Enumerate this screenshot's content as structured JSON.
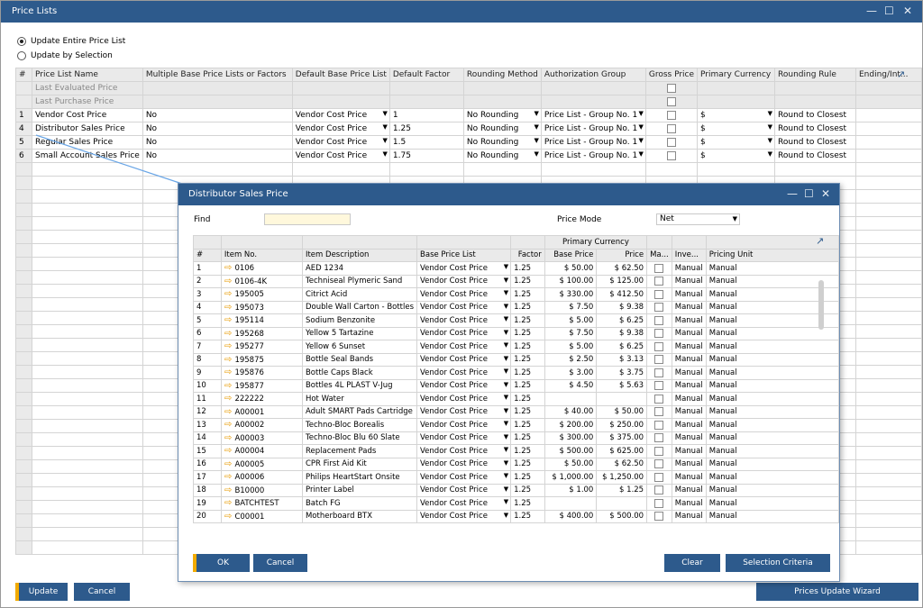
{
  "window": {
    "title": "Price Lists"
  },
  "options": {
    "update_entire": "Update Entire Price List",
    "update_selection": "Update by Selection"
  },
  "grid": {
    "headers": [
      "#",
      "Price List Name",
      "Multiple Base Price Lists or Factors",
      "Default Base Price List",
      "Default Factor",
      "Rounding Method",
      "Authorization Group",
      "Gross Price",
      "Primary Currency",
      "Rounding Rule",
      "Ending/Int..."
    ],
    "special_rows": [
      "Last Evaluated Price",
      "Last Purchase Price"
    ],
    "rows": [
      {
        "no": "1",
        "name": "Vendor Cost Price",
        "multi": "No",
        "base": "Vendor Cost Price",
        "factor": "1",
        "rounding": "No Rounding",
        "auth": "Price List - Group No. 1",
        "currency": "$",
        "rule": "Round to Closest"
      },
      {
        "no": "4",
        "name": "Distributor Sales Price",
        "multi": "No",
        "base": "Vendor Cost Price",
        "factor": "1.25",
        "rounding": "No Rounding",
        "auth": "Price List - Group No. 1",
        "currency": "$",
        "rule": "Round to Closest"
      },
      {
        "no": "5",
        "name": "Regular Sales Price",
        "multi": "No",
        "base": "Vendor Cost Price",
        "factor": "1.5",
        "rounding": "No Rounding",
        "auth": "Price List - Group No. 1",
        "currency": "$",
        "rule": "Round to Closest"
      },
      {
        "no": "6",
        "name": "Small Account Sales Price",
        "multi": "No",
        "base": "Vendor Cost Price",
        "factor": "1.75",
        "rounding": "No Rounding",
        "auth": "Price List - Group No. 1",
        "currency": "$",
        "rule": "Round to Closest"
      }
    ]
  },
  "buttons": {
    "update": "Update",
    "cancel": "Cancel",
    "wizard": "Prices Update Wizard"
  },
  "dialog": {
    "title": "Distributor Sales Price",
    "find_label": "Find",
    "find_value": "",
    "price_mode_label": "Price Mode",
    "price_mode_value": "Net",
    "group_header": "Primary Currency",
    "headers": [
      "#",
      "Item No.",
      "Item Description",
      "Base Price List",
      "Factor",
      "Base Price",
      "Price",
      "Ma...",
      "Inve...",
      "Pricing Unit"
    ],
    "rows": [
      {
        "n": "1",
        "item": "0106",
        "desc": "AED 1234",
        "base": "Vendor Cost Price",
        "factor": "1.25",
        "bp": "$ 50.00",
        "price": "$ 62.50",
        "inv": "Manual",
        "unit": "Manual"
      },
      {
        "n": "2",
        "item": "0106-4K",
        "desc": "Techniseal Plymeric Sand",
        "base": "Vendor Cost Price",
        "factor": "1.25",
        "bp": "$ 100.00",
        "price": "$ 125.00",
        "inv": "Manual",
        "unit": "Manual"
      },
      {
        "n": "3",
        "item": "195005",
        "desc": "Citrict Acid",
        "base": "Vendor Cost Price",
        "factor": "1.25",
        "bp": "$ 330.00",
        "price": "$ 412.50",
        "inv": "Manual",
        "unit": "Manual"
      },
      {
        "n": "4",
        "item": "195073",
        "desc": "Double Wall Carton - Bottles",
        "base": "Vendor Cost Price",
        "factor": "1.25",
        "bp": "$ 7.50",
        "price": "$ 9.38",
        "inv": "Manual",
        "unit": "Manual"
      },
      {
        "n": "5",
        "item": "195114",
        "desc": "Sodium Benzonite",
        "base": "Vendor Cost Price",
        "factor": "1.25",
        "bp": "$ 5.00",
        "price": "$ 6.25",
        "inv": "Manual",
        "unit": "Manual"
      },
      {
        "n": "6",
        "item": "195268",
        "desc": "Yellow 5 Tartazine",
        "base": "Vendor Cost Price",
        "factor": "1.25",
        "bp": "$ 7.50",
        "price": "$ 9.38",
        "inv": "Manual",
        "unit": "Manual"
      },
      {
        "n": "7",
        "item": "195277",
        "desc": "Yellow 6 Sunset",
        "base": "Vendor Cost Price",
        "factor": "1.25",
        "bp": "$ 5.00",
        "price": "$ 6.25",
        "inv": "Manual",
        "unit": "Manual"
      },
      {
        "n": "8",
        "item": "195875",
        "desc": "Bottle Seal Bands",
        "base": "Vendor Cost Price",
        "factor": "1.25",
        "bp": "$ 2.50",
        "price": "$ 3.13",
        "inv": "Manual",
        "unit": "Manual"
      },
      {
        "n": "9",
        "item": "195876",
        "desc": "Bottle Caps Black",
        "base": "Vendor Cost Price",
        "factor": "1.25",
        "bp": "$ 3.00",
        "price": "$ 3.75",
        "inv": "Manual",
        "unit": "Manual"
      },
      {
        "n": "10",
        "item": "195877",
        "desc": "Bottles 4L PLAST V-Jug",
        "base": "Vendor Cost Price",
        "factor": "1.25",
        "bp": "$ 4.50",
        "price": "$ 5.63",
        "inv": "Manual",
        "unit": "Manual"
      },
      {
        "n": "11",
        "item": "222222",
        "desc": "Hot Water",
        "base": "Vendor Cost Price",
        "factor": "1.25",
        "bp": "",
        "price": "",
        "inv": "Manual",
        "unit": "Manual"
      },
      {
        "n": "12",
        "item": "A00001",
        "desc": "Adult SMART Pads Cartridge",
        "base": "Vendor Cost Price",
        "factor": "1.25",
        "bp": "$ 40.00",
        "price": "$ 50.00",
        "inv": "Manual",
        "unit": "Manual"
      },
      {
        "n": "13",
        "item": "A00002",
        "desc": "Techno-Bloc Borealis",
        "base": "Vendor Cost Price",
        "factor": "1.25",
        "bp": "$ 200.00",
        "price": "$ 250.00",
        "inv": "Manual",
        "unit": "Manual"
      },
      {
        "n": "14",
        "item": "A00003",
        "desc": "Techno-Bloc Blu 60 Slate",
        "base": "Vendor Cost Price",
        "factor": "1.25",
        "bp": "$ 300.00",
        "price": "$ 375.00",
        "inv": "Manual",
        "unit": "Manual"
      },
      {
        "n": "15",
        "item": "A00004",
        "desc": "Replacement Pads",
        "base": "Vendor Cost Price",
        "factor": "1.25",
        "bp": "$ 500.00",
        "price": "$ 625.00",
        "inv": "Manual",
        "unit": "Manual"
      },
      {
        "n": "16",
        "item": "A00005",
        "desc": "CPR First Aid Kit",
        "base": "Vendor Cost Price",
        "factor": "1.25",
        "bp": "$ 50.00",
        "price": "$ 62.50",
        "inv": "Manual",
        "unit": "Manual"
      },
      {
        "n": "17",
        "item": "A00006",
        "desc": "Philips HeartStart Onsite",
        "base": "Vendor Cost Price",
        "factor": "1.25",
        "bp": "$ 1,000.00",
        "price": "$ 1,250.00",
        "inv": "Manual",
        "unit": "Manual"
      },
      {
        "n": "18",
        "item": "B10000",
        "desc": "Printer Label",
        "base": "Vendor Cost Price",
        "factor": "1.25",
        "bp": "$ 1.00",
        "price": "$ 1.25",
        "inv": "Manual",
        "unit": "Manual"
      },
      {
        "n": "19",
        "item": "BATCHTEST",
        "desc": "Batch FG",
        "base": "Vendor Cost Price",
        "factor": "1.25",
        "bp": "",
        "price": "",
        "inv": "Manual",
        "unit": "Manual"
      },
      {
        "n": "20",
        "item": "C00001",
        "desc": "Motherboard BTX",
        "base": "Vendor Cost Price",
        "factor": "1.25",
        "bp": "$ 400.00",
        "price": "$ 500.00",
        "inv": "Manual",
        "unit": "Manual"
      }
    ],
    "ok": "OK",
    "cancel": "Cancel",
    "clear": "Clear",
    "criteria": "Selection Criteria"
  }
}
